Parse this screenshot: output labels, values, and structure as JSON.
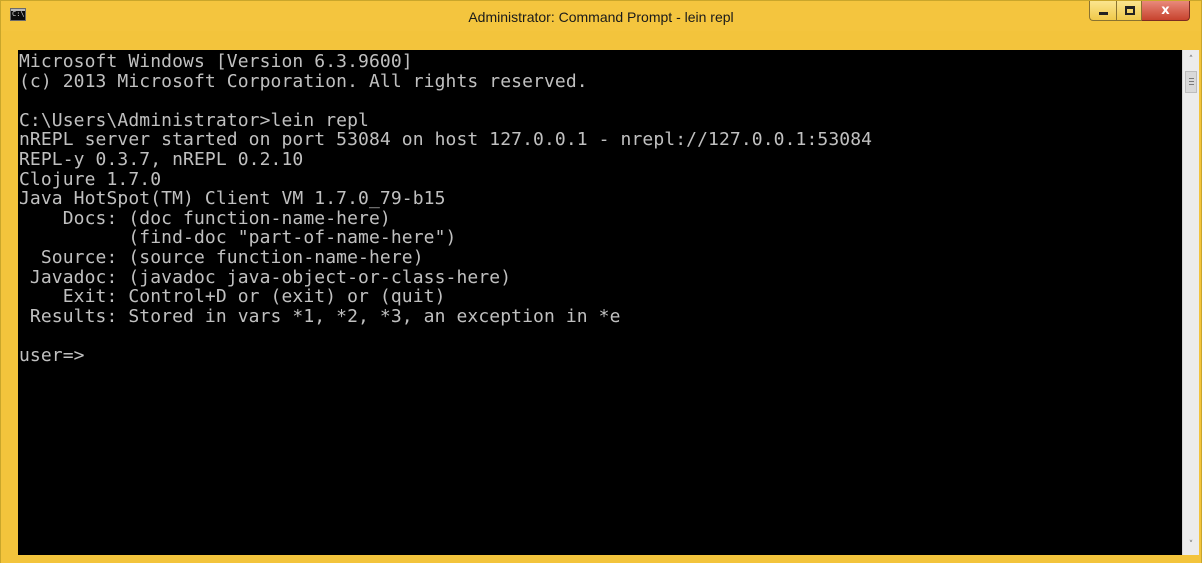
{
  "window": {
    "title": "Administrator: Command Prompt - lein  repl",
    "icon_name": "command-prompt-icon",
    "icon_text": "C:\\",
    "frame_color": "#f3c43c",
    "close_color": "#c7432e",
    "controls": {
      "minimize_icon": "minimize-icon",
      "maximize_icon": "maximize-icon",
      "close_label": "x"
    }
  },
  "console": {
    "background": "#000000",
    "foreground": "#c0c0c0",
    "lines": [
      "Microsoft Windows [Version 6.3.9600]",
      "(c) 2013 Microsoft Corporation. All rights reserved.",
      "",
      "C:\\Users\\Administrator>lein repl",
      "nREPL server started on port 53084 on host 127.0.0.1 - nrepl://127.0.0.1:53084",
      "REPL-y 0.3.7, nREPL 0.2.10",
      "Clojure 1.7.0",
      "Java HotSpot(TM) Client VM 1.7.0_79-b15",
      "    Docs: (doc function-name-here)",
      "          (find-doc \"part-of-name-here\")",
      "  Source: (source function-name-here)",
      " Javadoc: (javadoc java-object-or-class-here)",
      "    Exit: Control+D or (exit) or (quit)",
      " Results: Stored in vars *1, *2, *3, an exception in *e",
      "",
      "user=>"
    ]
  },
  "scrollbar": {
    "up_arrow": "^",
    "down_arrow": "v",
    "up_icon": "chevron-up-icon",
    "down_icon": "chevron-down-icon"
  }
}
